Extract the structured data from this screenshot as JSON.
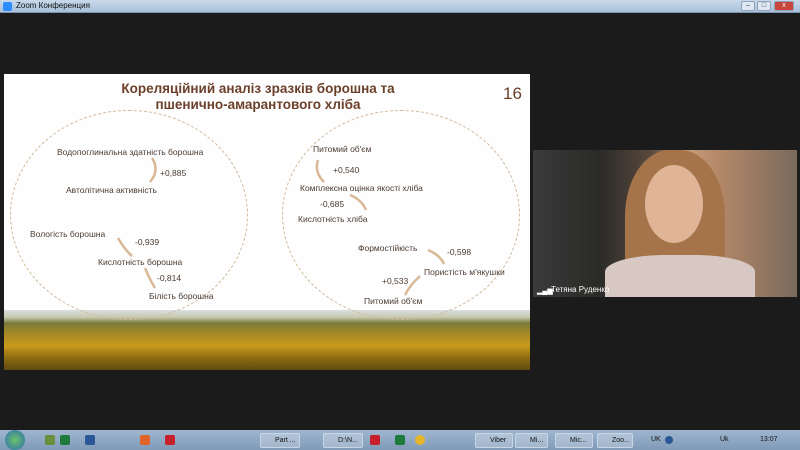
{
  "window": {
    "title": "Zoom Конференция",
    "min": "–",
    "max": "□",
    "close": "x"
  },
  "slide": {
    "title_line1": "Кореляційний аналіз зразків борошна та",
    "title_line2": "пшенично-амарантового хліба",
    "page_number": "16",
    "left": {
      "l1": "Водопоглинальна здатність борошна",
      "n1": "+0,885",
      "l2": "Автолітична активність",
      "l3": "Вологість борошна",
      "n2": "-0,939",
      "l4": "Кислотність борошна",
      "n3": "-0,814",
      "l5": "Білість борошна"
    },
    "right": {
      "l1": "Питомий об'єм",
      "n1": "+0,540",
      "l2": "Комплексна оцінка якості хліба",
      "n2": "-0,685",
      "l3": "Кислотність хліба",
      "l4": "Формостійкість",
      "n3": "-0,598",
      "l5": "Пористість м'якушки",
      "n4": "+0,533",
      "l6": "Питомий об'єм"
    }
  },
  "video": {
    "participant": "Тетяна Руденко"
  },
  "taskbar": {
    "items": [
      "Part ...",
      "D:\\N...",
      "Viber",
      "Mi...",
      "Mic...",
      "Zoo..."
    ],
    "lang": "UK",
    "lang2": "Uk",
    "clock": "13:07"
  },
  "colors": {
    "accent": "#6b3f2a",
    "arrow": "#d9b896"
  }
}
